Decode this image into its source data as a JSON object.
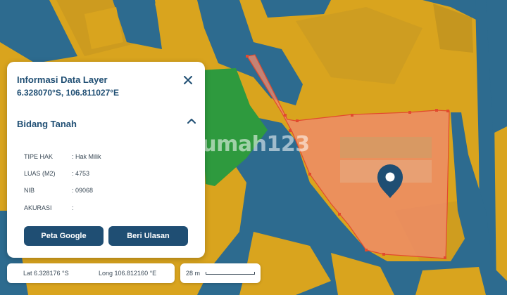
{
  "watermark": "rumah123",
  "panel": {
    "title": "Informasi Data Layer",
    "coordinates": "6.328070°S, 106.811027°E",
    "section_title": "Bidang Tanah",
    "attributes": [
      {
        "label": "TIPE HAK",
        "value": ": Hak Milik"
      },
      {
        "label": "LUAS (M2)",
        "value": ": 4753"
      },
      {
        "label": "NIB",
        "value": ": 09068"
      },
      {
        "label": "AKURASI",
        "value": ":"
      }
    ],
    "buttons": {
      "google_map": "Peta Google",
      "review": "Beri Ulasan"
    }
  },
  "coord_bar": {
    "lat": "Lat 6.328176 °S",
    "lng": "Long 106.812160 °E"
  },
  "scale": {
    "label": "28 m"
  },
  "colors": {
    "land": "#d9a41e",
    "water": "#2d6b8f",
    "park": "#2e9a3e",
    "parcel_fill": "#f08a6e",
    "parcel_edge": "#e24a2e",
    "accent": "#1f4e73"
  },
  "icons": [
    "close-icon",
    "chevron-up-icon",
    "map-pin-icon"
  ]
}
